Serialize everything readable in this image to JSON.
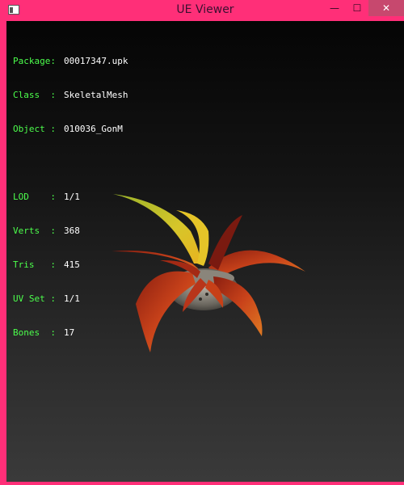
{
  "window": {
    "title": "UE Viewer"
  },
  "info": {
    "package": {
      "label": "Package:",
      "value": "00017347.upk"
    },
    "class": {
      "label": "Class  :",
      "value": "SkeletalMesh"
    },
    "object": {
      "label": "Object :",
      "value": "010036_GonM"
    },
    "lod": {
      "label": "LOD    :",
      "value": "1/1"
    },
    "verts": {
      "label": "Verts  :",
      "value": "368"
    },
    "tris": {
      "label": "Tris   :",
      "value": "415"
    },
    "uvset": {
      "label": "UV Set :",
      "value": "1/1"
    },
    "bones": {
      "label": "Bones  :",
      "value": "17"
    }
  },
  "colors": {
    "frame": "#ff2f78",
    "label": "#4cff4c",
    "value": "#ffffff"
  },
  "icons": {
    "app": "app-window-icon",
    "minimize": "minimize-icon",
    "maximize": "maximize-icon",
    "close": "close-icon"
  }
}
